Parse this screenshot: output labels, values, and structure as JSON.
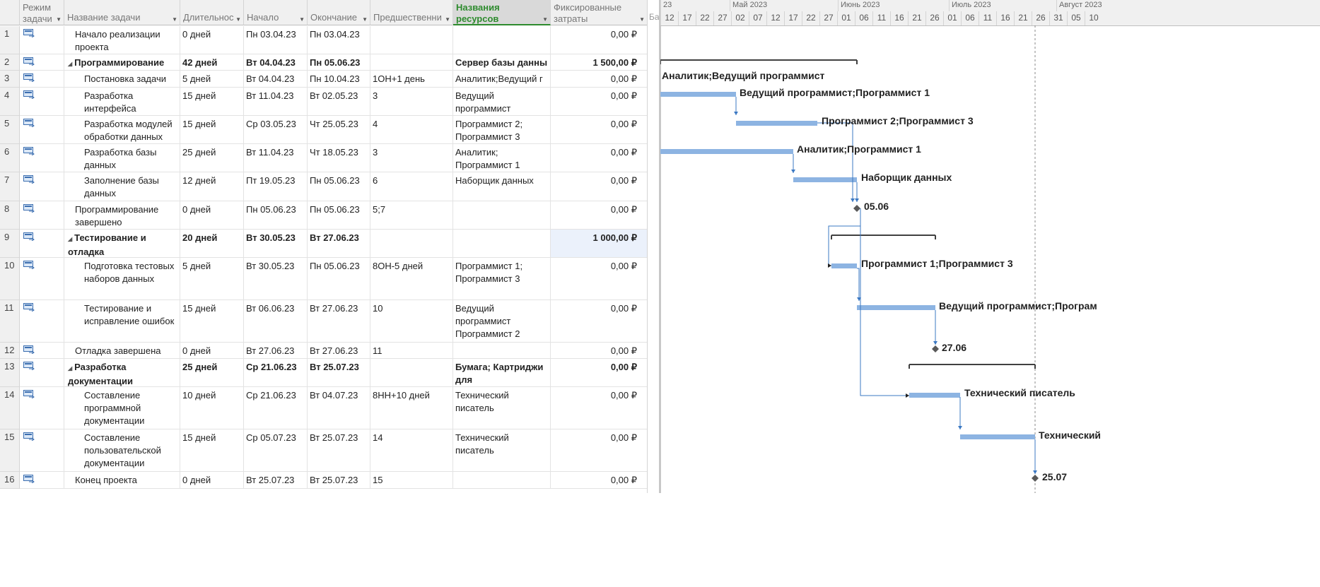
{
  "columns": {
    "mode": "Режим задачи",
    "name": "Название задачи",
    "duration": "Длительнос",
    "start": "Начало",
    "finish": "Окончание",
    "predecessors": "Предшественни",
    "resources": "Названия ресурсов",
    "fixed_cost": "Фиксированные затраты",
    "truncated_next": "Баз"
  },
  "rows": [
    {
      "num": "1",
      "name": "Начало реализации проекта",
      "duration": "0 дней",
      "start": "Пн 03.04.23",
      "finish": "Пн 03.04.23",
      "pred": "",
      "res": "",
      "cost": "0,00 ₽",
      "summary": false,
      "indent": 1
    },
    {
      "num": "2",
      "name": "Программирование",
      "duration": "42 дней",
      "start": "Вт 04.04.23",
      "finish": "Пн 05.06.23",
      "pred": "",
      "res": "Сервер базы данны",
      "cost": "1 500,00 ₽",
      "summary": true,
      "indent": 1
    },
    {
      "num": "3",
      "name": "Постановка задачи",
      "duration": "5 дней",
      "start": "Вт 04.04.23",
      "finish": "Пн 10.04.23",
      "pred": "1ОН+1 день",
      "res": "Аналитик;Ведущий г",
      "cost": "0,00 ₽",
      "summary": false,
      "indent": 2
    },
    {
      "num": "4",
      "name": "Разработка интерфейса",
      "duration": "15 дней",
      "start": "Вт 11.04.23",
      "finish": "Вт 02.05.23",
      "pred": "3",
      "res": "Ведущий программист",
      "cost": "0,00 ₽",
      "summary": false,
      "indent": 2
    },
    {
      "num": "5",
      "name": "Разработка модулей обработки данных",
      "duration": "15 дней",
      "start": "Ср 03.05.23",
      "finish": "Чт 25.05.23",
      "pred": "4",
      "res": "Программист 2; Программист 3",
      "cost": "0,00 ₽",
      "summary": false,
      "indent": 2
    },
    {
      "num": "6",
      "name": "Разработка базы данных",
      "duration": "25 дней",
      "start": "Вт 11.04.23",
      "finish": "Чт 18.05.23",
      "pred": "3",
      "res": "Аналитик; Программист 1",
      "cost": "0,00 ₽",
      "summary": false,
      "indent": 2
    },
    {
      "num": "7",
      "name": "Заполнение базы данных",
      "duration": "12 дней",
      "start": "Пт 19.05.23",
      "finish": "Пн 05.06.23",
      "pred": "6",
      "res": "Наборщик данных",
      "cost": "0,00 ₽",
      "summary": false,
      "indent": 2
    },
    {
      "num": "8",
      "name": "Программирование завершено",
      "duration": "0 дней",
      "start": "Пн 05.06.23",
      "finish": "Пн 05.06.23",
      "pred": "5;7",
      "res": "",
      "cost": "0,00 ₽",
      "summary": false,
      "indent": 1
    },
    {
      "num": "9",
      "name": "Тестирование и отладка",
      "duration": "20 дней",
      "start": "Вт 30.05.23",
      "finish": "Вт 27.06.23",
      "pred": "",
      "res": "",
      "cost": "1 000,00 ₽",
      "summary": true,
      "indent": 1,
      "highlight": true
    },
    {
      "num": "10",
      "name": "Подготовка тестовых наборов данных",
      "duration": "5 дней",
      "start": "Вт 30.05.23",
      "finish": "Пн 05.06.23",
      "pred": "8ОН-5 дней",
      "res": "Программист 1; Программист 3",
      "cost": "0,00 ₽",
      "summary": false,
      "indent": 2
    },
    {
      "num": "11",
      "name": "Тестирование и исправление ошибок",
      "duration": "15 дней",
      "start": "Вт 06.06.23",
      "finish": "Вт 27.06.23",
      "pred": "10",
      "res": "Ведущий программист Программист 2",
      "cost": "0,00 ₽",
      "summary": false,
      "indent": 2
    },
    {
      "num": "12",
      "name": "Отладка завершена",
      "duration": "0 дней",
      "start": "Вт 27.06.23",
      "finish": "Вт 27.06.23",
      "pred": "11",
      "res": "",
      "cost": "0,00 ₽",
      "summary": false,
      "indent": 1
    },
    {
      "num": "13",
      "name": "Разработка документации",
      "duration": "25 дней",
      "start": "Ср 21.06.23",
      "finish": "Вт 25.07.23",
      "pred": "",
      "res": "Бумага; Картриджи для",
      "cost": "0,00 ₽",
      "summary": true,
      "indent": 1
    },
    {
      "num": "14",
      "name": "Составление программной документации",
      "duration": "10 дней",
      "start": "Ср 21.06.23",
      "finish": "Вт 04.07.23",
      "pred": "8НН+10 дней",
      "res": "Технический писатель",
      "cost": "0,00 ₽",
      "summary": false,
      "indent": 2
    },
    {
      "num": "15",
      "name": "Составление пользовательской документации",
      "duration": "15 дней",
      "start": "Ср 05.07.23",
      "finish": "Вт 25.07.23",
      "pred": "14",
      "res": "Технический писатель",
      "cost": "0,00 ₽",
      "summary": false,
      "indent": 2
    },
    {
      "num": "16",
      "name": "Конец проекта",
      "duration": "0 дней",
      "start": "Вт 25.07.23",
      "finish": "Вт 25.07.23",
      "pred": "15",
      "res": "",
      "cost": "0,00 ₽",
      "summary": false,
      "indent": 1
    }
  ],
  "timeline": {
    "months": [
      "23",
      "Май 2023",
      "Июнь 2023",
      "Июль 2023",
      "Август 2023"
    ],
    "days": [
      "12",
      "17",
      "22",
      "27",
      "02",
      "07",
      "12",
      "17",
      "22",
      "27",
      "01",
      "06",
      "11",
      "16",
      "21",
      "26",
      "01",
      "06",
      "11",
      "16",
      "21",
      "26",
      "31",
      "05",
      "10"
    ]
  },
  "gantt_labels": {
    "l3": "Аналитик;Ведущий программист",
    "l4": "Ведущий программист;Программист 1",
    "l5": "Программист 2;Программист 3",
    "l6": "Аналитик;Программист 1",
    "l7": "Наборщик данных",
    "l8": "05.06",
    "l10": "Программист 1;Программист 3",
    "l11": "Ведущий программист;Програм",
    "l12": "27.06",
    "l14": "Технический писатель",
    "l15": "Технический",
    "l16": "25.07"
  },
  "colors": {
    "bar": "#8db4e2",
    "link": "#3b78c3",
    "summary": "#404040",
    "milestone": "#595959",
    "selected_header": "#2e8b2e"
  }
}
